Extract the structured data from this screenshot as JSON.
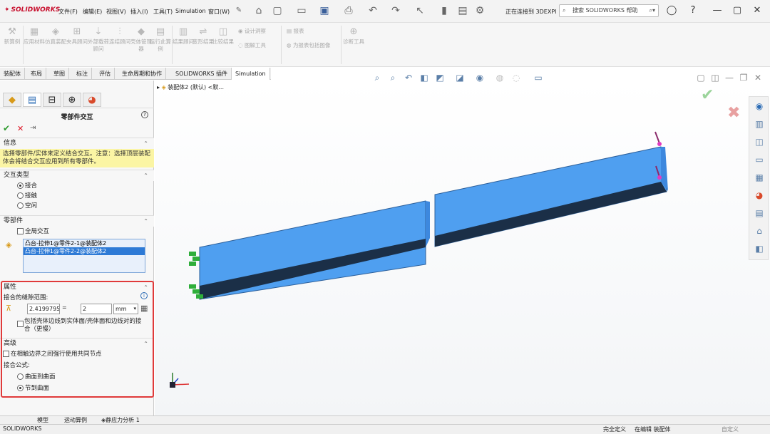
{
  "app": {
    "logo": "SOLIDWORKS",
    "menus": [
      "文件(F)",
      "编辑(E)",
      "视图(V)",
      "插入(I)",
      "工具(T)",
      "Simulation",
      "窗口(W)"
    ],
    "connection_status": "正在连接到 3DEXPI",
    "search_placeholder": "搜索 SOLIDWORKS 帮助"
  },
  "command_manager": {
    "items": [
      {
        "label": "新算例",
        "icon": "new-study-icon"
      },
      {
        "label": "应用材料",
        "icon": "apply-material-icon"
      },
      {
        "label": "仿真装配",
        "icon": "sim-assembly-icon"
      },
      {
        "label": "夹具顾问",
        "icon": "fixture-icon"
      },
      {
        "label": "外部载荷顾问",
        "icon": "load-icon"
      },
      {
        "label": "连结顾问",
        "icon": "connection-icon"
      },
      {
        "label": "壳体管理器",
        "icon": "shell-icon"
      },
      {
        "label": "运行此算例",
        "icon": "run-icon"
      },
      {
        "label": "结果顾问",
        "icon": "results-icon"
      },
      {
        "label": "变形结果",
        "icon": "deformed-icon"
      },
      {
        "label": "比较结果",
        "icon": "compare-icon"
      },
      {
        "label": "设计洞察",
        "icon": "design-insight-icon"
      },
      {
        "label": "图解工具",
        "icon": "plot-tools-icon"
      },
      {
        "label": "报表",
        "icon": "report-icon"
      },
      {
        "label": "为报表包括图像",
        "icon": "include-image-icon"
      },
      {
        "label": "诊断工具",
        "icon": "diagnostic-icon"
      }
    ]
  },
  "tabs": [
    "装配体",
    "布局",
    "草图",
    "标注",
    "评估",
    "生命周期和协作",
    "SOLIDWORKS 插件",
    "Simulation"
  ],
  "active_tab": "Simulation",
  "tree_label": "装配体2 (默认) <默...",
  "property_manager": {
    "title": "零部件交互",
    "info_header": "信息",
    "info_text": "选择零部件/实体来定义结合交互。注意：选择顶层装配体会将结合交互应用到所有零部件。",
    "interaction_type_header": "交互类型",
    "interaction_types": [
      "接合",
      "接触",
      "空闲"
    ],
    "interaction_selected": "接合",
    "components_header": "零部件",
    "global_interaction": "全局交互",
    "components": [
      "凸台-拉伸1@零件2-1@装配体2",
      "凸台-拉伸1@零件2-2@装配体2"
    ],
    "selected_component_index": 1,
    "properties_header": "属性",
    "bond_range_label": "接合的缝隙范围:",
    "bond_min": "2.419979559",
    "eq": "=",
    "bond_max": "2",
    "unit": "mm",
    "include_shell_label": "包括壳体边线到实体面/壳体面和边线对的接合（更慢）",
    "advanced_header": "高级",
    "force_common_nodes": "在相触边界之间强行使用共同节点",
    "bond_formula_label": "接合公式:",
    "formulas": [
      "曲面到曲面",
      "节到曲面"
    ],
    "formula_selected": "节到曲面"
  },
  "bottom_tabs": [
    "模型",
    "运动算例",
    "静应力分析 1"
  ],
  "status": {
    "left": "SOLIDWORKS",
    "middle1": "完全定义",
    "middle2": "在编辑 装配体",
    "right": "自定义"
  },
  "colors": {
    "beam_top": "#4f9ff0",
    "beam_front": "#3d88de",
    "beam_bottom": "#1b2f47",
    "highlight_red": "#e03a3a",
    "info_yellow": "#fbf5a4"
  }
}
